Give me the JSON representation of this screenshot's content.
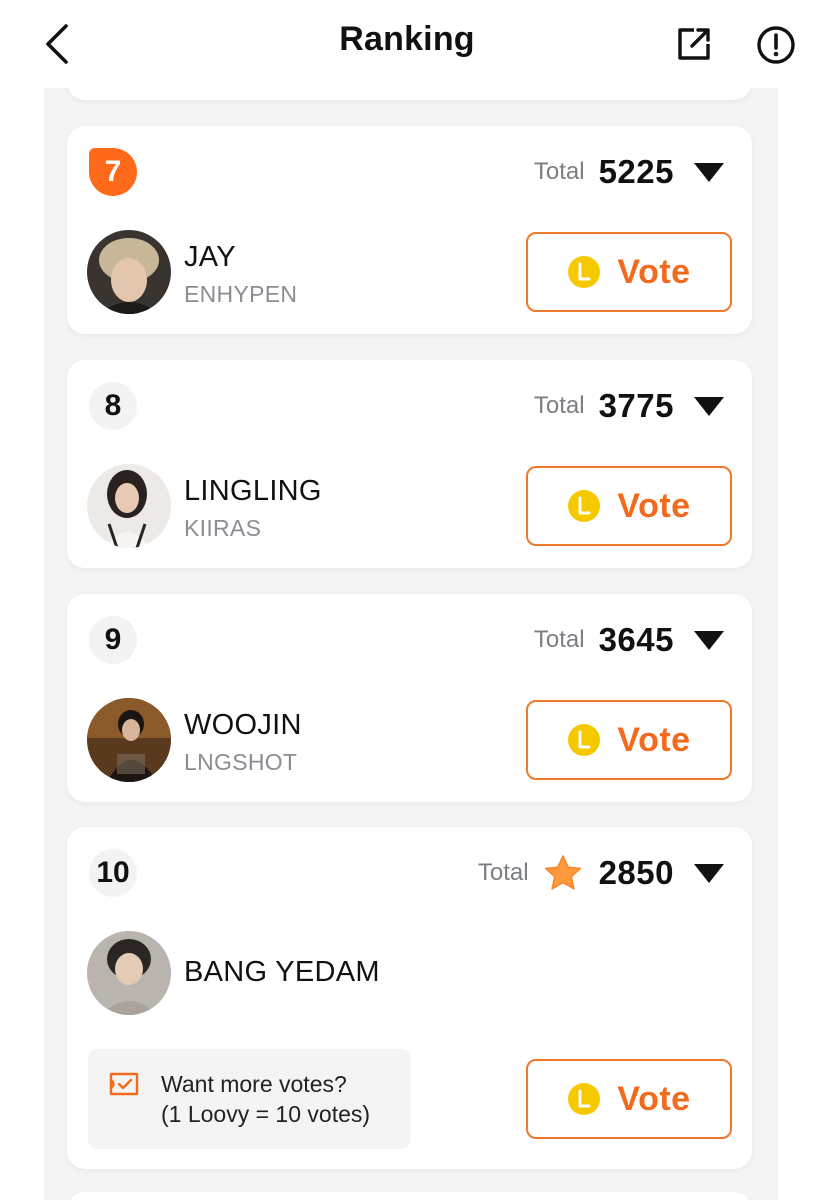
{
  "header": {
    "title": "Ranking",
    "back_icon": "chevron-left-icon",
    "share_icon": "external-link-icon",
    "info_icon": "info-circle-icon"
  },
  "colors": {
    "accent": "#f26a1c",
    "rank_top_badge": "#ff6a1a",
    "coin": "#f5c800",
    "text_primary": "#111111",
    "text_secondary": "#8a8e93",
    "list_background": "#f4f4f4"
  },
  "entries": [
    {
      "rank": "7",
      "total_label": "Total",
      "total": "5225",
      "name": "JAY",
      "group": "ENHYPEN",
      "vote_label": "Vote"
    },
    {
      "rank": "8",
      "total_label": "Total",
      "total": "3775",
      "name": "LINGLING",
      "group": "KIIRAS",
      "vote_label": "Vote"
    },
    {
      "rank": "9",
      "total_label": "Total",
      "total": "3645",
      "name": "WOOJIN",
      "group": "LNGSHOT",
      "vote_label": "Vote"
    },
    {
      "rank": "10",
      "total_label": "Total",
      "total": "2850",
      "name": "BANG YEDAM",
      "group": "",
      "vote_label": "Vote",
      "total_icon": "star-icon"
    }
  ],
  "promo": {
    "icon": "vote-ticket-icon",
    "line1": "Want more votes?",
    "line2": "(1 Loovy = 10 votes)"
  }
}
